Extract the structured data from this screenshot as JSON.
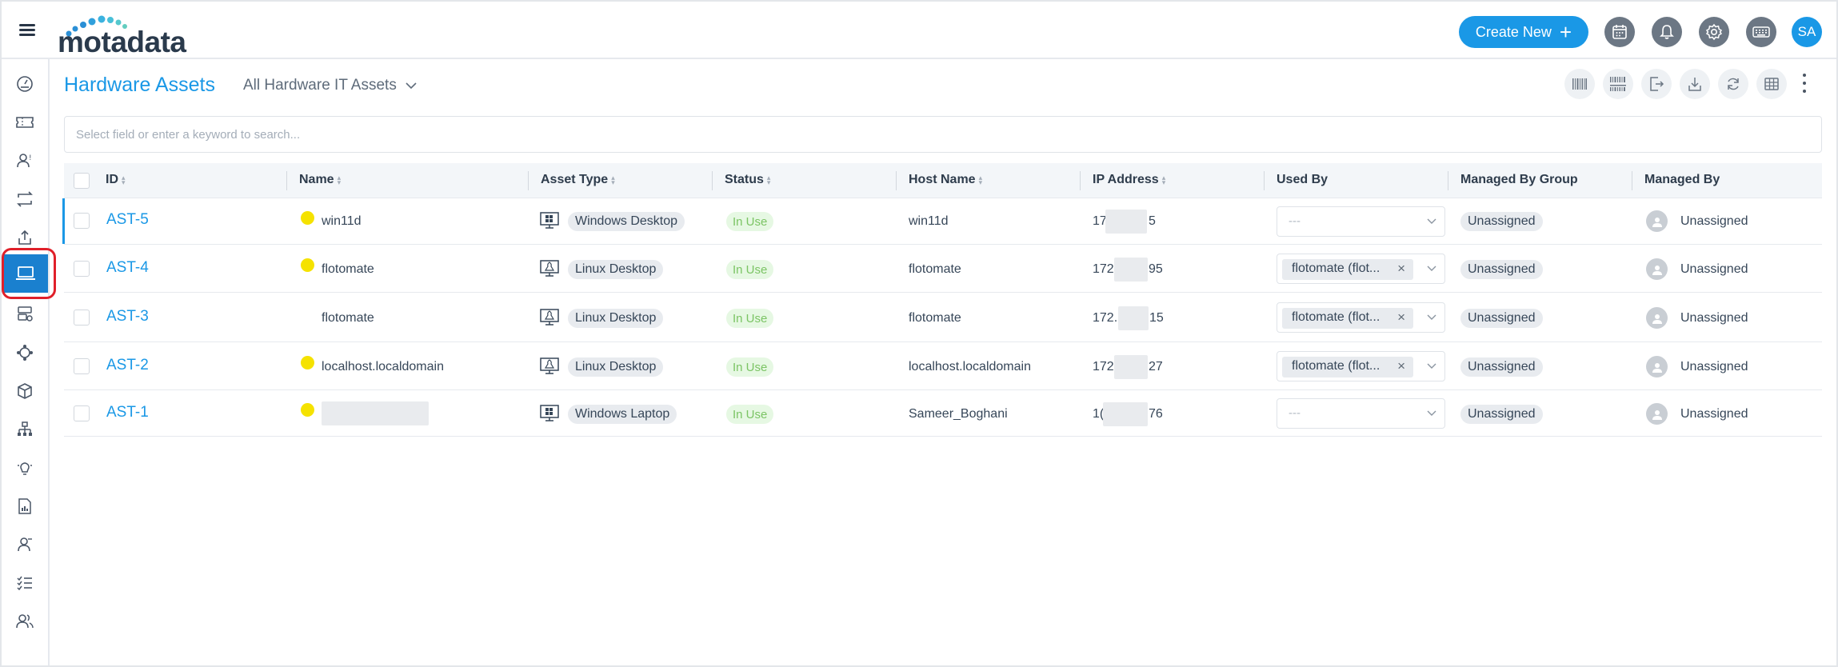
{
  "header": {
    "logo_text": "motadata",
    "create_label": "Create New",
    "avatar_initials": "SA",
    "icons": [
      "calendar-icon",
      "bell-icon",
      "gear-icon",
      "keyboard-icon"
    ]
  },
  "sidebar": {
    "items": [
      "dashboard-icon",
      "ticket-icon",
      "user-request-icon",
      "change-icon",
      "release-icon",
      "asset-icon",
      "cmdb-icon",
      "integration-icon",
      "product-icon",
      "project-icon",
      "knowledge-icon",
      "report-icon",
      "contact-icon",
      "task-icon",
      "team-icon"
    ],
    "active": "asset-icon"
  },
  "page": {
    "title": "Hardware Assets",
    "view": "All Hardware IT Assets"
  },
  "search": {
    "placeholder": "Select field or enter a keyword to search..."
  },
  "table": {
    "columns": [
      "ID",
      "Name",
      "Asset Type",
      "Status",
      "Host Name",
      "IP Address",
      "Used By",
      "Managed By Group",
      "Managed By"
    ],
    "rows": [
      {
        "id": "AST-5",
        "name": "win11d",
        "asset_type": "Windows Desktop",
        "status": "In Use",
        "host": "win11d",
        "ip_start": "17:",
        "ip_end": "5",
        "used_by": "---",
        "group": "Unassigned",
        "managed_by": "Unassigned"
      },
      {
        "id": "AST-4",
        "name": "flotomate",
        "asset_type": "Linux Desktop",
        "status": "In Use",
        "host": "flotomate",
        "ip_start": "172",
        "ip_end": "95",
        "used_by": "flotomate (flot...",
        "group": "Unassigned",
        "managed_by": "Unassigned"
      },
      {
        "id": "AST-3",
        "name": "flotomate",
        "asset_type": "Linux Desktop",
        "status": "In Use",
        "host": "flotomate",
        "ip_start": "172.",
        "ip_end": "15",
        "used_by": "flotomate (flot...",
        "group": "Unassigned",
        "managed_by": "Unassigned"
      },
      {
        "id": "AST-2",
        "name": "localhost.localdomain",
        "asset_type": "Linux Desktop",
        "status": "In Use",
        "host": "localhost.localdomain",
        "ip_start": "172",
        "ip_end": "27",
        "used_by": "flotomate (flot...",
        "group": "Unassigned",
        "managed_by": "Unassigned"
      },
      {
        "id": "AST-1",
        "name": "",
        "asset_type": "Windows Laptop",
        "status": "In Use",
        "host": "Sameer_Boghani",
        "ip_start": "1(",
        "ip_end": "76",
        "used_by": "---",
        "group": "Unassigned",
        "managed_by": "Unassigned"
      }
    ]
  },
  "colors": {
    "accent": "#1a98e6",
    "status_green": "#7bc464",
    "status_bg": "#e6f8e3",
    "online_dot": "#f5e200",
    "highlight_red": "#e0202a"
  }
}
